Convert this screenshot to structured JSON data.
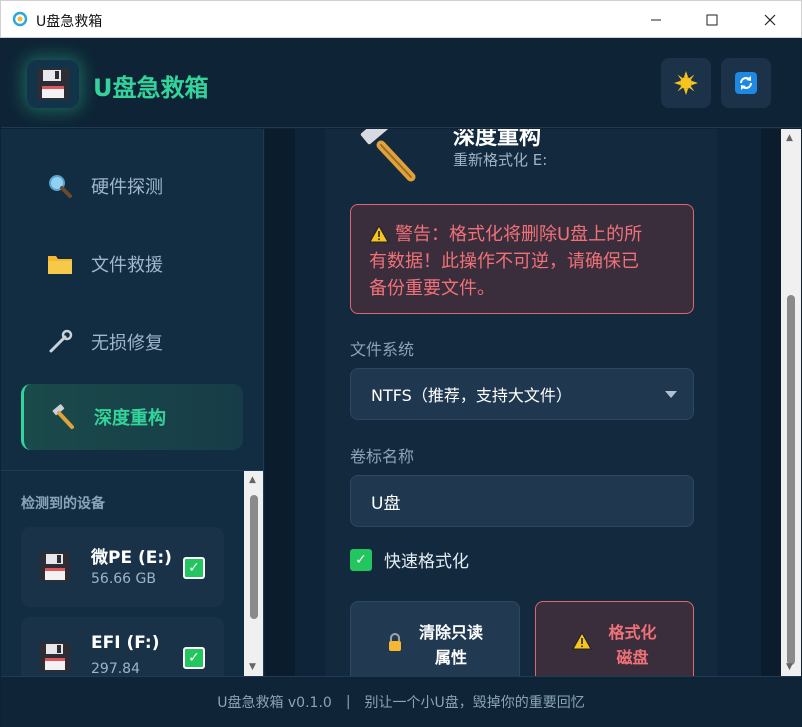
{
  "window": {
    "title": "U盘急救箱",
    "minimize_glyph": "—",
    "maximize_glyph": "☐",
    "close_glyph": "✕"
  },
  "header": {
    "brand": "U盘急救箱",
    "logo_icon": "floppy-disk-icon",
    "theme_icon": "sun-icon",
    "refresh_icon": "refresh-icon",
    "accent_color": "#34d399"
  },
  "sidebar": {
    "nav": [
      {
        "label": "硬件探测",
        "icon": "magnifier-icon",
        "active": false
      },
      {
        "label": "文件救援",
        "icon": "folder-icon",
        "active": false
      },
      {
        "label": "无损修复",
        "icon": "wrench-icon",
        "active": false
      },
      {
        "label": "深度重构",
        "icon": "hammer-icon",
        "active": true
      }
    ],
    "devices_title": "检测到的设备",
    "devices": [
      {
        "name": "微PE (E:)",
        "size": "56.66 GB",
        "checked": true
      },
      {
        "name": "EFI (F:)",
        "size": "297.84",
        "checked": true
      }
    ]
  },
  "main": {
    "section_title": "深度重构",
    "section_subtitle": "重新格式化 E:",
    "warning_line1": "警告：格式化将删除U盘上的所",
    "warning_line2": "有数据！此操作不可逆，请确保已",
    "warning_line3": "备份重要文件。",
    "fs_label": "文件系统",
    "fs_value": "NTFS（推荐，支持大文件）",
    "volume_label": "卷标名称",
    "volume_value": "U盘",
    "quick_format_label": "快速格式化",
    "quick_format_checked": true,
    "btn_readonly_line1": "清除只读",
    "btn_readonly_line2": "属性",
    "btn_format_line1": "格式化",
    "btn_format_line2": "磁盘",
    "danger_color": "#f07178"
  },
  "footer": {
    "version": "U盘急救箱 v0.1.0",
    "separator": "|",
    "slogan": "别让一个小U盘，毁掉你的重要回忆"
  }
}
